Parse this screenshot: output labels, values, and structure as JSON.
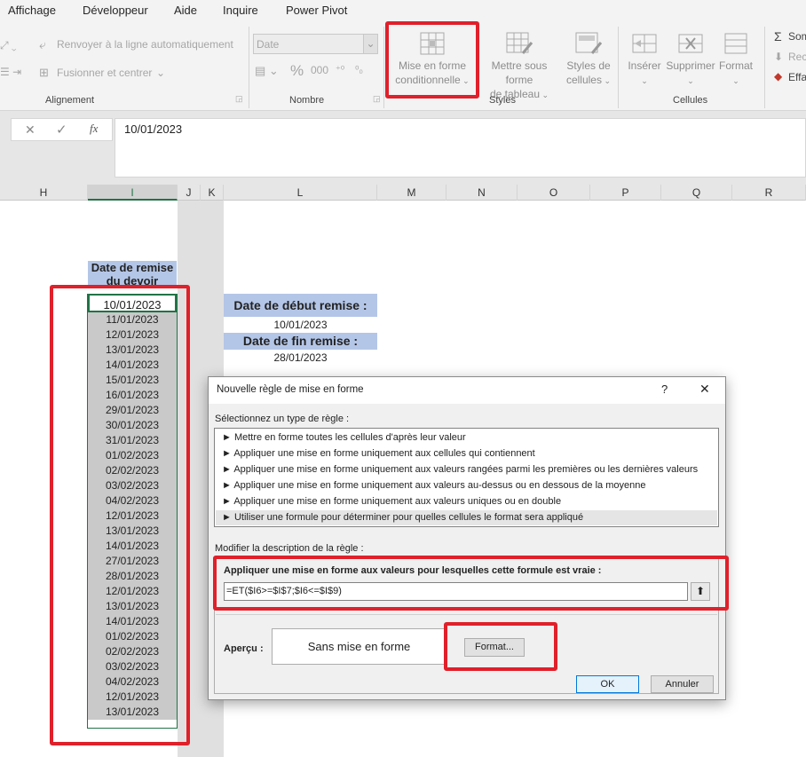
{
  "menu_tabs": [
    "Affichage",
    "Développeur",
    "Aide",
    "Inquire",
    "Power Pivot"
  ],
  "ribbon": {
    "alignment": {
      "wrap_text": "Renvoyer à la ligne automatiquement",
      "merge_center": "Fusionner et centrer",
      "group_label": "Alignement"
    },
    "number": {
      "format_value": "Date",
      "group_label": "Nombre"
    },
    "styles": {
      "conditional_formatting_line1": "Mise en forme",
      "conditional_formatting_line2": "conditionnelle",
      "format_as_table_line1": "Mettre sous forme",
      "format_as_table_line2": "de tableau",
      "cell_styles_line1": "Styles de",
      "cell_styles_line2": "cellules",
      "group_label": "Styles"
    },
    "cells": {
      "insert": "Insérer",
      "delete": "Supprimer",
      "format": "Format",
      "group_label": "Cellules"
    },
    "editing": {
      "sum": "Som",
      "fill": "Rec",
      "clear": "Effa"
    }
  },
  "formula_bar": {
    "fx_label": "fx",
    "value": "10/01/2023"
  },
  "columns": [
    "H",
    "I",
    "J",
    "K",
    "L",
    "M",
    "N",
    "O",
    "P",
    "Q",
    "R"
  ],
  "sheet": {
    "header_line1": "Date de remise",
    "header_line2": "du devoir",
    "dates": [
      "10/01/2023",
      "11/01/2023",
      "12/01/2023",
      "13/01/2023",
      "14/01/2023",
      "15/01/2023",
      "16/01/2023",
      "29/01/2023",
      "30/01/2023",
      "31/01/2023",
      "01/02/2023",
      "02/02/2023",
      "03/02/2023",
      "04/02/2023",
      "12/01/2023",
      "13/01/2023",
      "14/01/2023",
      "27/01/2023",
      "28/01/2023",
      "12/01/2023",
      "13/01/2023",
      "14/01/2023",
      "01/02/2023",
      "02/02/2023",
      "03/02/2023",
      "04/02/2023",
      "12/01/2023",
      "13/01/2023"
    ],
    "start_label": "Date de début remise :",
    "start_value": "10/01/2023",
    "end_label": "Date de fin remise :",
    "end_value": "28/01/2023"
  },
  "dialog": {
    "title": "Nouvelle règle de mise en forme",
    "help": "?",
    "close": "✕",
    "select_type_label": "Sélectionnez un type de règle :",
    "rule_types": [
      "Mettre en forme toutes les cellules d'après leur valeur",
      "Appliquer une mise en forme uniquement aux cellules qui contiennent",
      "Appliquer une mise en forme uniquement aux valeurs rangées parmi les premières ou les dernières valeurs",
      "Appliquer une mise en forme uniquement aux valeurs au-dessus ou en dessous de la moyenne",
      "Appliquer une mise en forme uniquement aux valeurs uniques ou en double",
      "Utiliser une formule pour déterminer pour quelles cellules le format sera appliqué"
    ],
    "edit_desc_label": "Modifier la description de la règle :",
    "formula_label": "Appliquer une mise en forme aux valeurs pour lesquelles cette formule est vraie :",
    "formula_value": "=ET($I6>=$I$7;$I6<=$I$9)",
    "preview_label": "Aperçu :",
    "preview_text": "Sans mise en forme",
    "format_button": "Format...",
    "ok_button": "OK",
    "cancel_button": "Annuler"
  },
  "colors": {
    "highlight_red": "#e0202a",
    "header_blue": "#b4c6e7",
    "selected_gray": "#c9c9c9",
    "excel_green": "#217346"
  }
}
